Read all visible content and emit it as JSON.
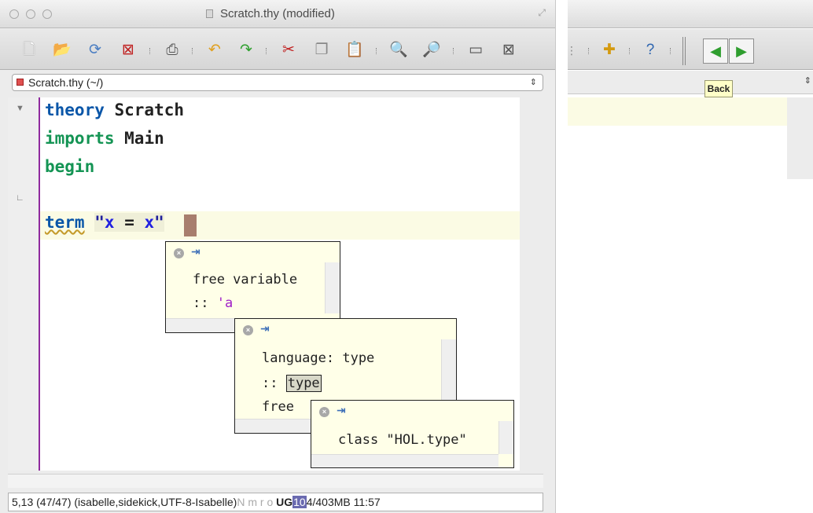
{
  "window": {
    "title": "Scratch.thy (modified)"
  },
  "toolbar": {
    "icons": [
      "new-file-icon",
      "open-file-icon",
      "reload-icon",
      "close-file-icon",
      "print-icon",
      "undo-icon",
      "redo-icon",
      "cut-icon",
      "copy-icon",
      "paste-icon",
      "find-icon",
      "find-in-files-icon",
      "new-view-icon",
      "unsplit-icon"
    ]
  },
  "buffer": {
    "selected": "Scratch.thy (~/)"
  },
  "editor": {
    "lines": [
      {
        "keyword": "theory",
        "rest": " Scratch"
      },
      {
        "keyword": "imports",
        "rest": " Main"
      },
      {
        "keyword": "begin",
        "rest": ""
      },
      {
        "keyword": "term",
        "string_open": "\"",
        "var1": "x",
        "middle": " = ",
        "var2": "x",
        "string_close": "\""
      }
    ]
  },
  "tooltips": [
    {
      "line1": "free variable",
      "line2_prefix": ":: ",
      "line2_value": "'a"
    },
    {
      "line1": "language: type",
      "line2_prefix": ":: ",
      "line2_value": "type",
      "line3": "free"
    },
    {
      "line1": "class \"HOL.type\""
    }
  ],
  "status": {
    "position": "5,13 (47/47)",
    "mode": "(isabelle,sidekick,UTF-8-Isabelle)",
    "flags": "N m r o",
    "flags_bold": "UG",
    "mem_highlight": "10",
    "memory_rest": "4/403MB",
    "time": "11:57"
  },
  "right_window": {
    "back_tooltip": "Back",
    "icons": [
      "plugin-icon",
      "help-icon",
      "back-arrow-icon",
      "forward-arrow-icon"
    ]
  },
  "colors": {
    "keyword_blue": "#0a56a8",
    "keyword_green": "#149454",
    "gutter_line": "#8f2a9e",
    "caret": "#a87e6e",
    "tooltip_bg": "#ffffe8"
  }
}
